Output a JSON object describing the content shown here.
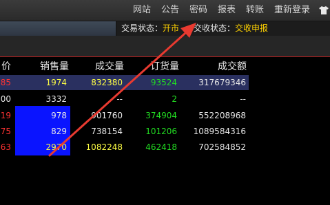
{
  "menu": {
    "items": [
      "网站",
      "公告",
      "密码",
      "报表",
      "转账",
      "重新登录"
    ],
    "icon": "shirt-icon"
  },
  "status": {
    "trade_label": "交易状态：",
    "trade_value": "开市",
    "settle_label": "交收状态：",
    "settle_value": "交收申报"
  },
  "table": {
    "headers": [
      "价",
      "销售量",
      "成交量",
      "订货量",
      "成交额"
    ],
    "rows": [
      {
        "price": "85",
        "sales": "1974",
        "volume": "832380",
        "orders": "93524",
        "amount": "317679346"
      },
      {
        "price": "00",
        "sales": "3332",
        "volume": "--",
        "orders": "2",
        "amount": "--"
      },
      {
        "price": "19",
        "sales": "978",
        "volume": "901760",
        "orders": "374904",
        "amount": "552208968"
      },
      {
        "price": "75",
        "sales": "829",
        "volume": "738154",
        "orders": "101206",
        "amount": "1089584316"
      },
      {
        "price": "63",
        "sales": "2970",
        "volume": "1082248",
        "orders": "462418",
        "amount": "702584852"
      }
    ]
  },
  "colors": {
    "price_red": "#ff3333",
    "price_white": "#e8e8e8",
    "sales_yellow": "#ffff44",
    "orders_green": "#22dd22",
    "amount_white": "#e8e8e8",
    "accent_yellow": "#ffd200",
    "arrow_red": "#e83a30"
  }
}
